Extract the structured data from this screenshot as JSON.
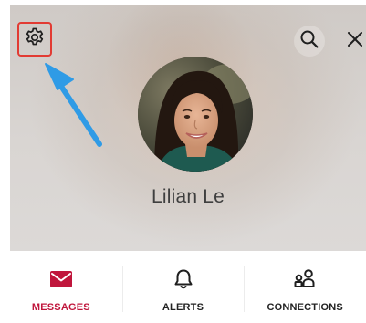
{
  "profile": {
    "name": "Lilian Le"
  },
  "header_actions": {
    "settings_icon": "gear-icon",
    "search_icon": "search-icon",
    "close_icon": "close-icon"
  },
  "tabs": [
    {
      "label": "MESSAGES",
      "icon": "envelope-icon",
      "active": true
    },
    {
      "label": "ALERTS",
      "icon": "bell-icon",
      "active": false
    },
    {
      "label": "CONNECTIONS",
      "icon": "people-icon",
      "active": false
    }
  ],
  "colors": {
    "accent": "#c0163c",
    "highlight_box": "#e23b33",
    "annotation_arrow": "#2f9be6",
    "name_text": "#3f3f3f"
  }
}
